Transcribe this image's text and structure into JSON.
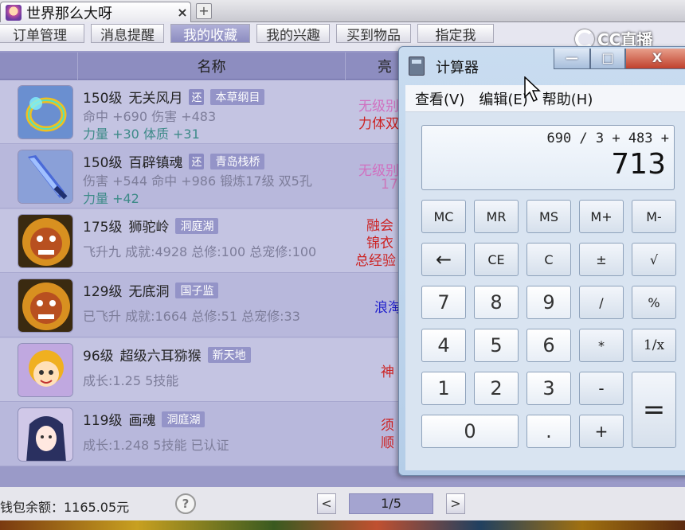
{
  "browser": {
    "tab_title": "世界那么大呀",
    "tab_close": "×",
    "new_tab": "+"
  },
  "nav": [
    "订单管理",
    "消息提醒",
    "我的收藏",
    "我的兴趣",
    "买到物品",
    "指定我"
  ],
  "overlay_logo": "CC直播",
  "columns": {
    "name": "名称",
    "bright": "亮"
  },
  "items": [
    {
      "line1": [
        "150级",
        "无关风月"
      ],
      "badges": [
        "还",
        "本草纲目"
      ],
      "line2": "命中 +690 伤害 +483",
      "line3": "力量 +30 体质 +31",
      "right": [
        "无级别",
        "力体双"
      ],
      "right_colors": [
        "#d070c0",
        "#cc2222"
      ]
    },
    {
      "line1": [
        "150级",
        "百辟镇魂"
      ],
      "badges": [
        "还",
        "青岛栈桥"
      ],
      "line2": "伤害 +544 命中 +986 锻炼17级 双5孔",
      "line3": "力量 +42",
      "right": [
        "无级别",
        "17"
      ],
      "right_colors": [
        "#d070c0",
        "#cc77bb"
      ]
    },
    {
      "line1": [
        "175级",
        "狮驼岭"
      ],
      "badges": [
        "洞庭湖"
      ],
      "line2": "飞升九 成就:4928 总修:100 总宠修:100",
      "right": [
        "融会",
        "锦衣",
        "总经验"
      ],
      "right_colors": [
        "#cc2222",
        "#cc2222",
        "#cc2222"
      ]
    },
    {
      "line1": [
        "129级",
        "无底洞"
      ],
      "badges": [
        "国子监"
      ],
      "line2": "已飞升 成就:1664 总修:51 总宠修:33",
      "right": [
        "浪淘"
      ],
      "right_colors": [
        "#2222cc"
      ]
    },
    {
      "line1": [
        "96级",
        "超级六耳猕猴"
      ],
      "badges": [
        "新天地"
      ],
      "line2": "成长:1.25 5技能",
      "right": [
        "神"
      ],
      "right_colors": [
        "#cc2222"
      ]
    },
    {
      "line1": [
        "119级",
        "画魂"
      ],
      "badges": [
        "洞庭湖"
      ],
      "line2": "成长:1.248 5技能 已认证",
      "right": [
        "须",
        "顺"
      ],
      "right_colors": [
        "#cc2222",
        "#cc2222"
      ]
    }
  ],
  "footer": {
    "wallet": "钱包余额：1165.05元",
    "help": "?",
    "prev": "<",
    "page": "1/5",
    "next": ">"
  },
  "calculator": {
    "title": "计算器",
    "window_buttons": [
      "—",
      "□",
      "X"
    ],
    "menu": [
      "查看(V)",
      "编辑(E)",
      "帮助(H)"
    ],
    "expression": "690 / 3 + 483 +",
    "result": "713",
    "keys": [
      "MC",
      "MR",
      "MS",
      "M+",
      "M-",
      "←",
      "CE",
      "C",
      "±",
      "√",
      "7",
      "8",
      "9",
      "/",
      "%",
      "4",
      "5",
      "6",
      "*",
      "1/x",
      "1",
      "2",
      "3",
      "-",
      "=",
      "0",
      ".",
      "+"
    ]
  }
}
